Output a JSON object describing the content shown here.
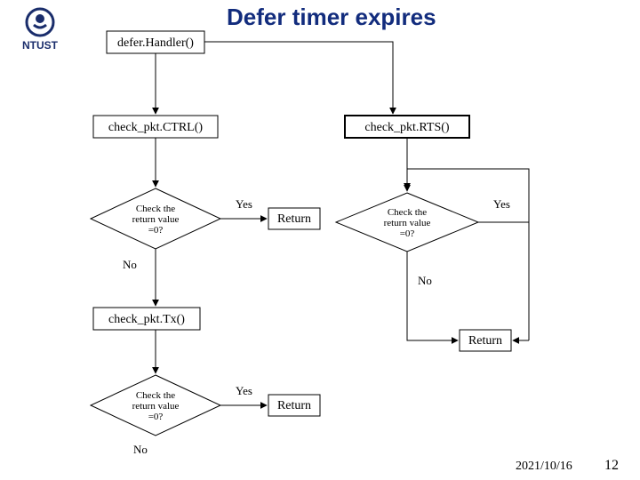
{
  "title": "Defer timer expires",
  "logo": {
    "org": "NTUST"
  },
  "nodes": {
    "start": "defer.Handler()",
    "ctrl": "check_pkt.CTRL()",
    "rts": "check_pkt.RTS()",
    "tx": "check_pkt.Tx()",
    "decision_line1": "Check the",
    "decision_line2": "return value",
    "decision_line3": "=0?",
    "return": "Return"
  },
  "labels": {
    "yes": "Yes",
    "no": "No"
  },
  "footer": {
    "date": "2021/10/16",
    "slide": "12"
  },
  "chart_data": {
    "type": "flowchart",
    "title": "Defer timer expires",
    "nodes": [
      {
        "id": "start",
        "type": "process",
        "text": "defer.Handler()"
      },
      {
        "id": "ctrl",
        "type": "process",
        "text": "check_pkt.CTRL()"
      },
      {
        "id": "d1",
        "type": "decision",
        "text": "Check the return value =0?"
      },
      {
        "id": "r1",
        "type": "terminal",
        "text": "Return"
      },
      {
        "id": "tx",
        "type": "process",
        "text": "check_pkt.Tx()"
      },
      {
        "id": "d2",
        "type": "decision",
        "text": "Check the return value =0?"
      },
      {
        "id": "r2",
        "type": "terminal",
        "text": "Return"
      },
      {
        "id": "rts",
        "type": "process",
        "text": "check_pkt.RTS()"
      },
      {
        "id": "d3",
        "type": "decision",
        "text": "Check the return value =0?"
      },
      {
        "id": "r3",
        "type": "terminal",
        "text": "Return"
      }
    ],
    "edges": [
      {
        "from": "start",
        "to": "ctrl"
      },
      {
        "from": "ctrl",
        "to": "d1"
      },
      {
        "from": "d1",
        "to": "r1",
        "label": "Yes"
      },
      {
        "from": "d1",
        "to": "tx",
        "label": "No"
      },
      {
        "from": "tx",
        "to": "d2"
      },
      {
        "from": "d2",
        "to": "r2",
        "label": "Yes"
      },
      {
        "from": "start",
        "to": "rts"
      },
      {
        "from": "rts",
        "to": "d3"
      },
      {
        "from": "d3",
        "to": "r3",
        "label": "No"
      },
      {
        "from": "d3",
        "to": "d3",
        "label": "Yes",
        "note": "loop back"
      }
    ]
  }
}
